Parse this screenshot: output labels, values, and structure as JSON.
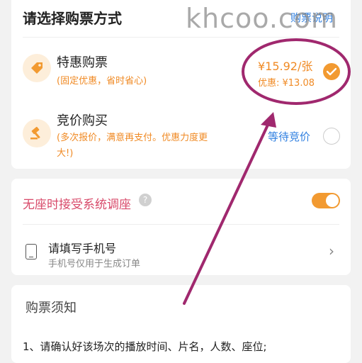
{
  "header": {
    "title": "请选择购票方式",
    "help_link": "购票说明"
  },
  "watermark": "khcoo.com",
  "options": [
    {
      "title": "特惠购票",
      "subtitle": "(固定优惠，省时省心)",
      "price": "¥15.92/张",
      "discount": "优惠: ¥13.08",
      "selected": true,
      "icon": "tag-icon"
    },
    {
      "title": "竞价购买",
      "subtitle_line1": "(多次报价，满意再支付。优惠力度更",
      "subtitle_line2": "大!)",
      "status": "等待竞价",
      "selected": false,
      "icon": "gavel-icon"
    }
  ],
  "seat": {
    "label": "无座时接受系统调座",
    "help": "?",
    "toggle_on": true
  },
  "phone": {
    "label": "请填写手机号",
    "sublabel": "手机号仅用于生成订单",
    "chevron": "›"
  },
  "notice": {
    "title": "购票须知",
    "line1": "1、请确认好该场次的播放时间、片名，人数、座位;"
  },
  "colors": {
    "accent": "#f29a31",
    "link": "#2f7fe0",
    "annotation": "#a0286e"
  }
}
